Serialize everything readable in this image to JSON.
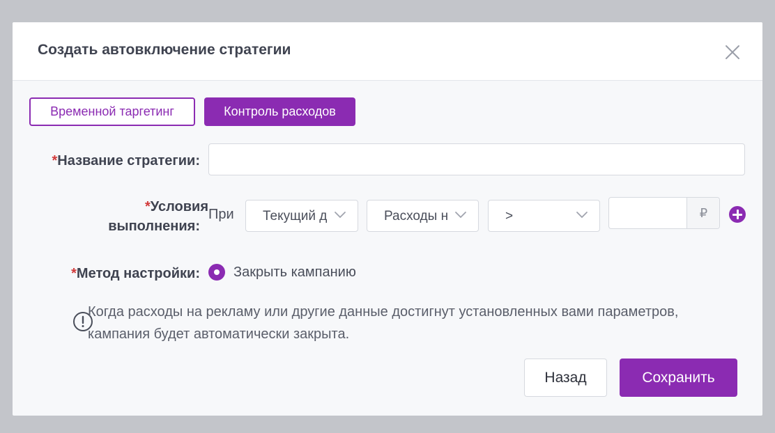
{
  "modal": {
    "title": "Создать автовключение стратегии"
  },
  "tabs": [
    {
      "label": "Временной таргетинг",
      "active": false
    },
    {
      "label": "Контроль расходов",
      "active": true
    }
  ],
  "form": {
    "required_mark": "*",
    "name_label": "Название стратегии:",
    "name_value": "",
    "conditions_label_line1": "Условия",
    "conditions_label_line2": "выполнения:",
    "conditions_prefix": "При",
    "select_period": "Текущий день",
    "select_metric": "Расходы на рекламу",
    "select_operator": ">",
    "amount_value": "",
    "currency": "₽",
    "method_label": "Метод настройки:",
    "method_option": "Закрыть кампанию",
    "info_text": "Когда расходы на рекламу или другие данные достигнут установленных вами параметров, кампания будет автоматически закрыта."
  },
  "buttons": {
    "back": "Назад",
    "save": "Сохранить"
  },
  "colors": {
    "accent": "#8b2bb2",
    "required": "#d23a3a",
    "overlay": "#c3c5ca"
  },
  "icons": {
    "close": "close-icon",
    "chevron": "chevron-down-icon",
    "add": "plus-circle-icon",
    "info": "exclamation-circle-icon"
  }
}
